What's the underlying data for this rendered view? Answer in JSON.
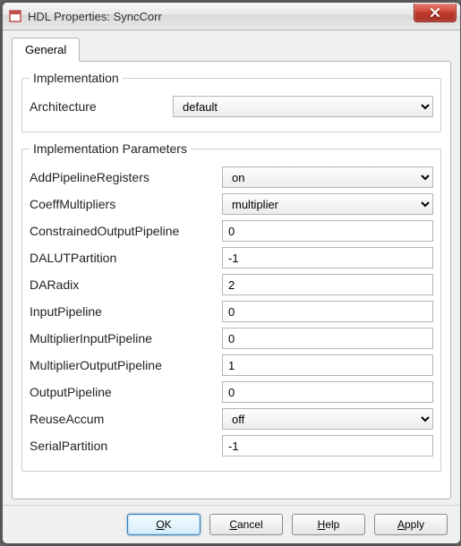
{
  "window": {
    "title": "HDL Properties: SyncCorr"
  },
  "tabs": {
    "general": "General"
  },
  "implementation": {
    "legend": "Implementation",
    "architecture": {
      "label": "Architecture",
      "value": "default"
    }
  },
  "params": {
    "legend": "Implementation Parameters",
    "addPipelineRegisters": {
      "label": "AddPipelineRegisters",
      "value": "on"
    },
    "coeffMultipliers": {
      "label": "CoeffMultipliers",
      "value": "multiplier"
    },
    "constrainedOutputPipeline": {
      "label": "ConstrainedOutputPipeline",
      "value": "0"
    },
    "dalutPartition": {
      "label": "DALUTPartition",
      "value": "-1"
    },
    "daRadix": {
      "label": "DARadix",
      "value": "2"
    },
    "inputPipeline": {
      "label": "InputPipeline",
      "value": "0"
    },
    "multiplierInputPipeline": {
      "label": "MultiplierInputPipeline",
      "value": "0"
    },
    "multiplierOutputPipeline": {
      "label": "MultiplierOutputPipeline",
      "value": "1"
    },
    "outputPipeline": {
      "label": "OutputPipeline",
      "value": "0"
    },
    "reuseAccum": {
      "label": "ReuseAccum",
      "value": "off"
    },
    "serialPartition": {
      "label": "SerialPartition",
      "value": "-1"
    }
  },
  "buttons": {
    "ok": "OK",
    "cancel": "Cancel",
    "help": "Help",
    "apply": "Apply"
  }
}
